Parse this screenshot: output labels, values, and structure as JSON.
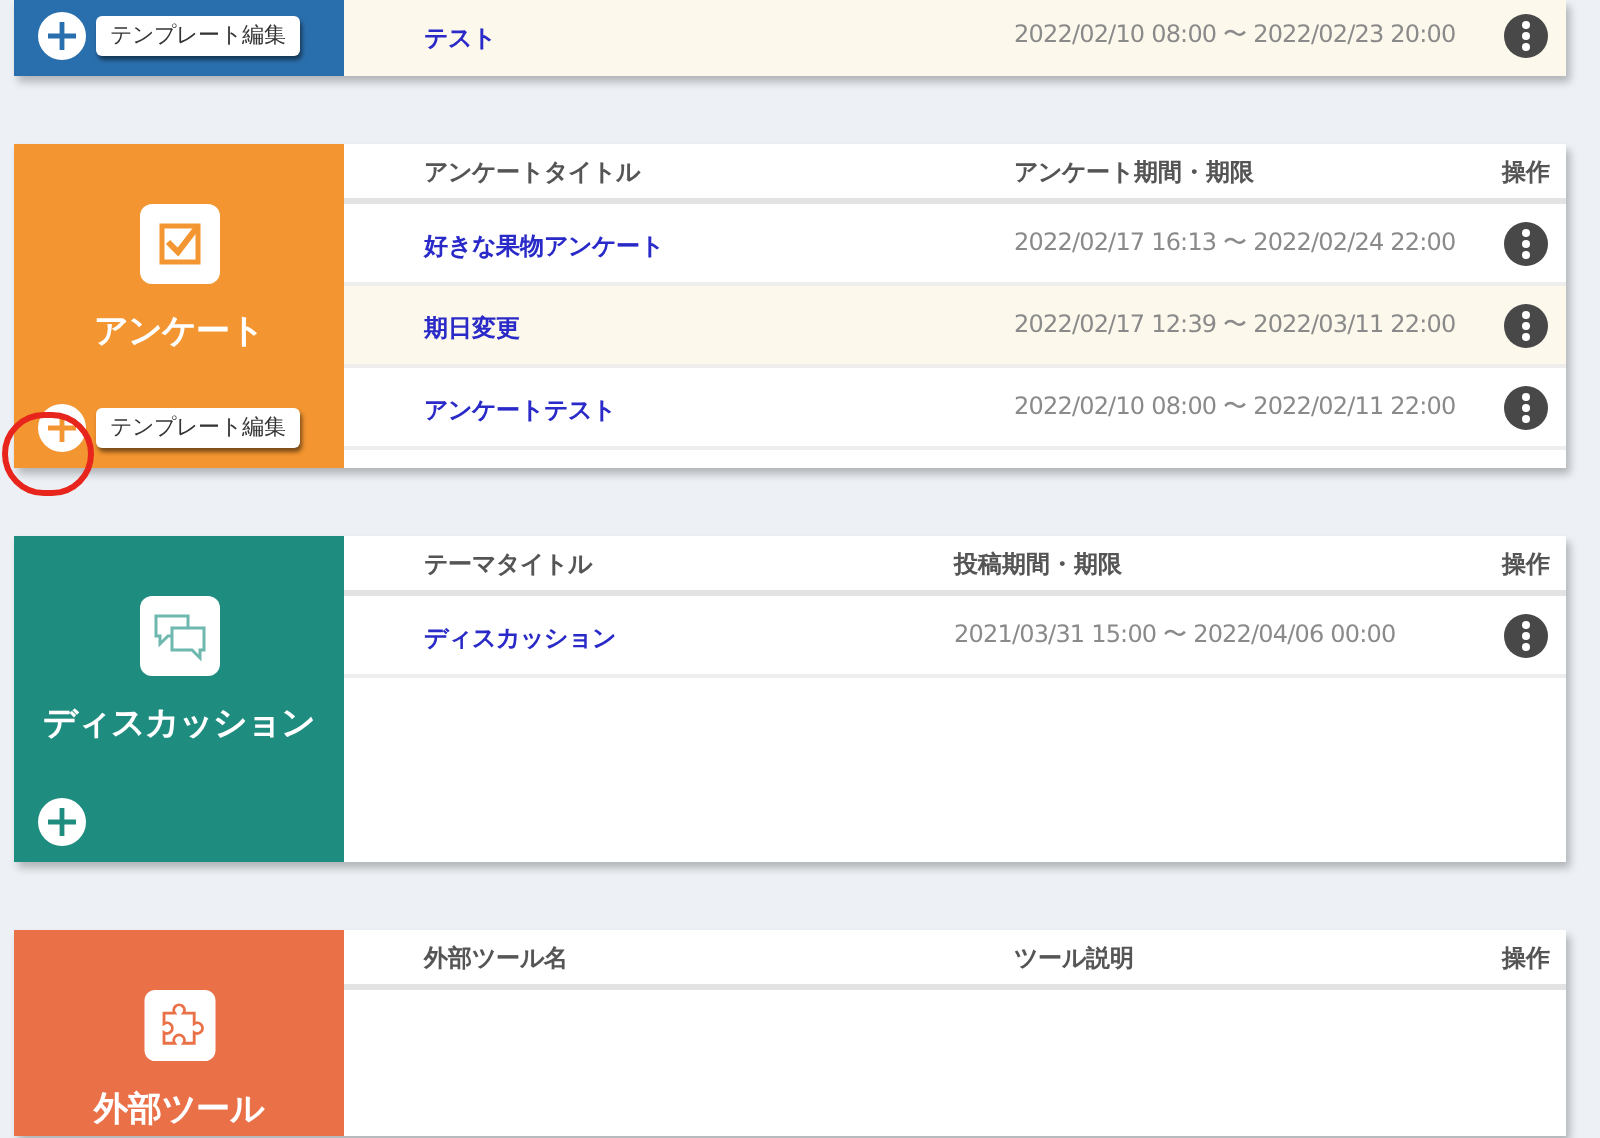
{
  "sections": [
    {
      "kind": "template",
      "color": "#2a6fad",
      "add_circled": false,
      "template_button": "テンプレート編集",
      "rows": [
        {
          "title": "テスト",
          "period": "2022/02/10 08:00 〜 2022/02/23 20:00",
          "highlighted": true
        }
      ]
    },
    {
      "kind": "survey",
      "color": "#f39530",
      "title": "アンケート",
      "add_circled": true,
      "template_button": "テンプレート編集",
      "columns": [
        "アンケートタイトル",
        "アンケート期間・期限",
        "操作"
      ],
      "rows": [
        {
          "title": "好きな果物アンケート",
          "period": "2022/02/17 16:13 〜 2022/02/24 22:00",
          "highlighted": false
        },
        {
          "title": "期日変更",
          "period": "2022/02/17 12:39 〜 2022/03/11 22:00",
          "highlighted": true
        },
        {
          "title": "アンケートテスト",
          "period": "2022/02/10 08:00 〜 2022/02/11 22:00",
          "highlighted": false
        }
      ]
    },
    {
      "kind": "discussion",
      "color": "#1e8c7f",
      "title": "ディスカッション",
      "add_circled": false,
      "columns": [
        "テーマタイトル",
        "投稿期間・期限",
        "操作"
      ],
      "rows": [
        {
          "title": "ディスカッション",
          "period": "2021/03/31 15:00 〜 2022/04/06 00:00",
          "highlighted": false
        }
      ]
    },
    {
      "kind": "tool",
      "color": "#ea7048",
      "title": "外部ツール",
      "columns": [
        "外部ツール名",
        "ツール説明",
        "操作"
      ]
    }
  ]
}
